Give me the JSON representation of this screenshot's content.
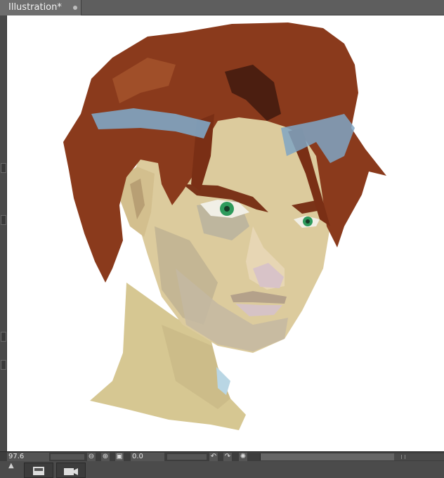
{
  "tab": {
    "title": "Illustration*"
  },
  "status": {
    "zoom": "97.6",
    "angle": "0.0"
  },
  "icons": {
    "zoom_out": "zoom-out-icon",
    "zoom_in": "zoom-in-icon",
    "fit": "fit-canvas-icon",
    "rotate_left": "rotate-left-icon",
    "rotate_right": "rotate-right-icon",
    "reset_rotation": "reset-rotation-icon",
    "collapse": "chevron-up-icon",
    "canvas_view": "canvas-view-icon",
    "timelapse": "video-camera-icon"
  },
  "colors": {
    "hair": "#8a3a1c",
    "hair_highlight": "#7fa6c4",
    "skin": "#d8c89a",
    "iris": "#2e9a5c",
    "ui_bg": "#5a5a5a"
  }
}
